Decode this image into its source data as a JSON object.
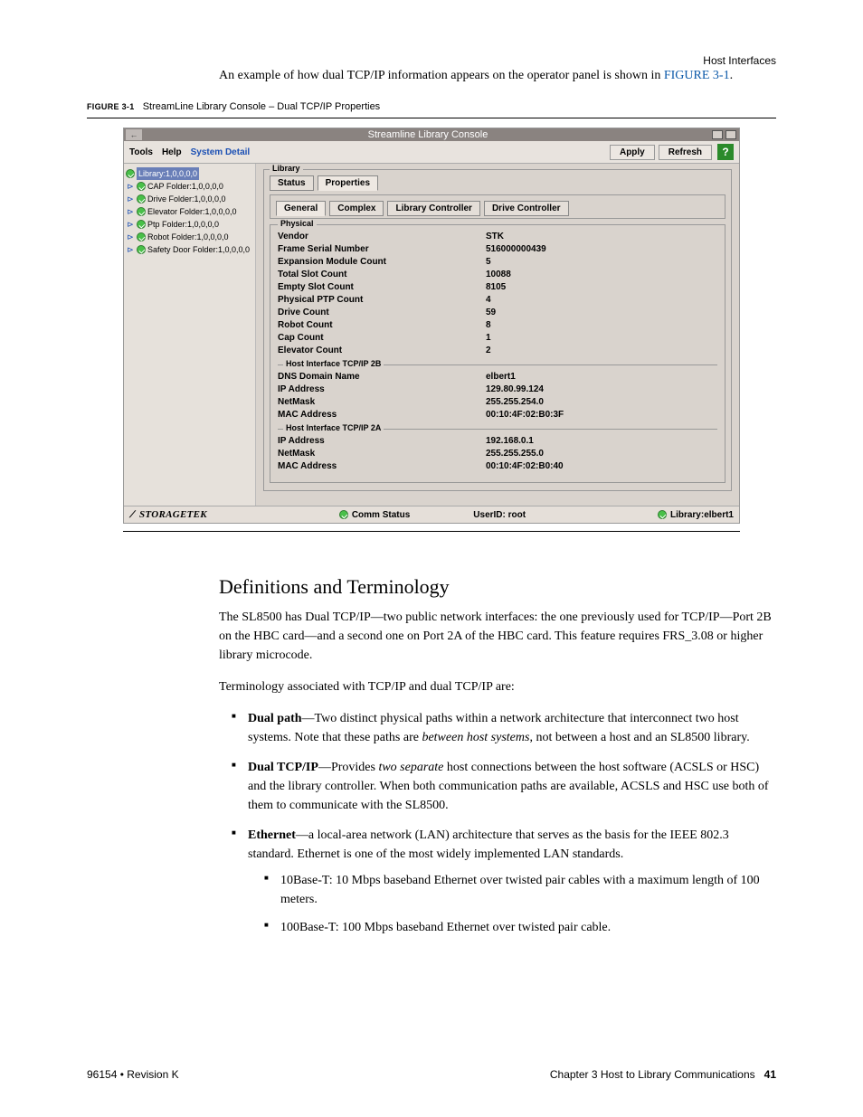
{
  "headerRight": "Host Interfaces",
  "intro_a": "An example of how dual TCP/IP information appears on the operator panel is shown in ",
  "intro_link": "FIGURE 3-1",
  "intro_b": ".",
  "figcap_tag": "FIGURE 3-1",
  "figcap_text": "StreamLine Library Console – Dual TCP/IP Properties",
  "win": {
    "title": "Streamline Library Console",
    "menus": {
      "tools": "Tools",
      "help": "Help",
      "sysdetail": "System Detail"
    },
    "buttons": {
      "apply": "Apply",
      "refresh": "Refresh",
      "help": "?"
    },
    "tree": [
      "Library:1,0,0,0,0",
      "CAP Folder:1,0,0,0,0",
      "Drive Folder:1,0,0,0,0",
      "Elevator Folder:1,0,0,0,0",
      "Ptp Folder:1,0,0,0,0",
      "Robot Folder:1,0,0,0,0",
      "Safety Door Folder:1,0,0,0,0"
    ],
    "panel": {
      "legend": "Library",
      "toptabs": {
        "status": "Status",
        "properties": "Properties"
      },
      "subtabs": {
        "general": "General",
        "complex": "Complex",
        "libctrl": "Library Controller",
        "drvctrl": "Drive Controller"
      },
      "physical_legend": "Physical",
      "physical": [
        {
          "l": "Vendor",
          "v": "STK"
        },
        {
          "l": "Frame Serial Number",
          "v": "516000000439"
        },
        {
          "l": "Expansion Module Count",
          "v": "5"
        },
        {
          "l": "Total Slot Count",
          "v": "10088"
        },
        {
          "l": "Empty Slot Count",
          "v": "8105"
        },
        {
          "l": "Physical PTP Count",
          "v": "4"
        },
        {
          "l": "Drive Count",
          "v": "59"
        },
        {
          "l": "Robot Count",
          "v": "8"
        },
        {
          "l": "Cap Count",
          "v": "1"
        },
        {
          "l": "Elevator Count",
          "v": "2"
        }
      ],
      "if2b_label": "Host Interface TCP/IP 2B",
      "if2b": [
        {
          "l": "DNS Domain Name",
          "v": "elbert1"
        },
        {
          "l": "IP Address",
          "v": "129.80.99.124"
        },
        {
          "l": "NetMask",
          "v": "255.255.254.0"
        },
        {
          "l": "MAC Address",
          "v": "00:10:4F:02:B0:3F"
        }
      ],
      "if2a_label": "Host Interface TCP/IP 2A",
      "if2a": [
        {
          "l": "IP Address",
          "v": "192.168.0.1"
        },
        {
          "l": "NetMask",
          "v": "255.255.255.0"
        },
        {
          "l": "MAC Address",
          "v": "00:10:4F:02:B0:40"
        }
      ]
    },
    "status": {
      "logo": "STORAGETEK",
      "comm": "Comm Status",
      "user": "UserID: root",
      "lib": "Library:elbert1"
    }
  },
  "defs": {
    "heading": "Definitions and Terminology",
    "p1": "The SL8500 has Dual TCP/IP—two public network interfaces: the one previously used for TCP/IP—Port 2B on the HBC card—and a second one on Port 2A of the HBC card. This feature requires FRS_3.08 or higher library microcode.",
    "p2": "Terminology associated with TCP/IP and dual TCP/IP are:",
    "b1_a": "Dual path",
    "b1_b": "—Two distinct physical paths within a network architecture that interconnect two host systems. Note that these paths are ",
    "b1_i": "between host systems",
    "b1_c": ", not between a host and an SL8500 library.",
    "b2_a": "Dual TCP/IP",
    "b2_b": "—Provides ",
    "b2_i": "two separate",
    "b2_c": " host connections between the host software (ACSLS or HSC) and the library controller. When both communication paths are available, ACSLS and HSC use both of them to communicate with the SL8500.",
    "b3_a": "Ethernet",
    "b3_b": "—a local-area network (LAN) architecture that serves as the basis for the IEEE 802.3 standard. Ethernet is one of the most widely implemented LAN standards.",
    "b3s1": "10Base-T: 10 Mbps baseband Ethernet over twisted pair cables with a maximum length of 100 meters.",
    "b3s2": "100Base-T: 100 Mbps baseband Ethernet over twisted pair cable."
  },
  "footer": {
    "left": "96154 • Revision K",
    "right_a": "Chapter 3 Host to Library Communications",
    "right_b": "41"
  }
}
